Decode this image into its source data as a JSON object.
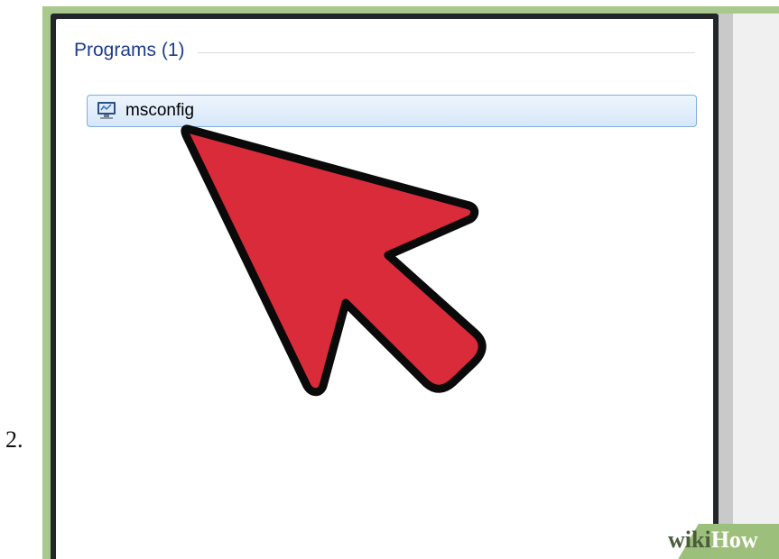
{
  "step": {
    "number": "2."
  },
  "search_results": {
    "group_label": "Programs (1)",
    "items": [
      {
        "label": "msconfig",
        "icon": "system-config-icon"
      }
    ]
  },
  "annotation": {
    "arrow_icon": "pointer-arrow-icon",
    "arrow_color": "#d92b3a"
  },
  "watermark": {
    "part1": "wiki",
    "part2": "How"
  },
  "colors": {
    "frame_green": "#a9c98c",
    "group_header_blue": "#1e3c8c",
    "selection_border": "#84acdd"
  }
}
